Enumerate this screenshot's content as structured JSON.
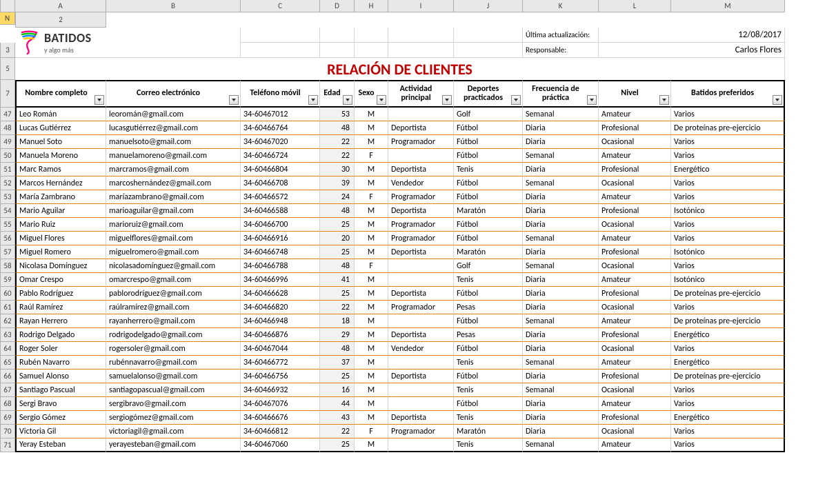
{
  "columns": [
    "A",
    "B",
    "C",
    "D",
    "H",
    "I",
    "J",
    "K",
    "L",
    "M",
    "N"
  ],
  "selected_column": "N",
  "logo": {
    "brand": "BATIDOS",
    "tagline": "y algo más"
  },
  "meta": {
    "last_update_label": "Última actualización:",
    "last_update_value": "12/08/2017",
    "resp_label": "Responsable:",
    "resp_value": "Carlos Flores"
  },
  "title": "RELACIÓN DE CLIENTES",
  "header_row_num": "7",
  "headers": [
    "Nombre completo",
    "Correo electrónico",
    "Teléfono móvil",
    "Edad",
    "Sexo",
    "Actividad principal",
    "Deportes practicados",
    "Frecuencia de práctica",
    "Nivel",
    "Batidos preferidos"
  ],
  "rows": [
    {
      "n": "47",
      "v": [
        "Leo Román",
        "leoromán@gmail.com",
        "34-60467012",
        "53",
        "M",
        "",
        "Golf",
        "Semanal",
        "Amateur",
        "Varios"
      ]
    },
    {
      "n": "48",
      "v": [
        "Lucas Gutiérrez",
        "lucasgutiérrez@gmail.com",
        "34-60466764",
        "48",
        "M",
        "Deportista",
        "Fútbol",
        "Diaria",
        "Profesional",
        "De proteínas pre-ejercicio"
      ]
    },
    {
      "n": "49",
      "v": [
        "Manuel Soto",
        "manuelsoto@gmail.com",
        "34-60467020",
        "22",
        "M",
        "Programador",
        "Fútbol",
        "Diaria",
        "Ocasional",
        "Varios"
      ]
    },
    {
      "n": "50",
      "v": [
        "Manuela Moreno",
        "manuelamoreno@gmail.com",
        "34-60466724",
        "22",
        "F",
        "",
        "Fútbol",
        "Semanal",
        "Amateur",
        "Varios"
      ]
    },
    {
      "n": "51",
      "v": [
        "Marc Ramos",
        "marcramos@gmail.com",
        "34-60466804",
        "30",
        "M",
        "Deportista",
        "Tenis",
        "Diaria",
        "Profesional",
        "Energético"
      ]
    },
    {
      "n": "52",
      "v": [
        "Marcos Hernández",
        "marcoshernández@gmail.com",
        "34-60466708",
        "39",
        "M",
        "Vendedor",
        "Fútbol",
        "Semanal",
        "Ocasional",
        "Varios"
      ]
    },
    {
      "n": "53",
      "v": [
        "María Zambrano",
        "maríazambrano@gmail.com",
        "34-60466572",
        "24",
        "F",
        "Programador",
        "Fútbol",
        "Diaria",
        "Amateur",
        "Varios"
      ]
    },
    {
      "n": "54",
      "v": [
        "Mario Aguilar",
        "marioaguilar@gmail.com",
        "34-60466588",
        "48",
        "M",
        "Deportista",
        "Maratón",
        "Diaria",
        "Profesional",
        "Isotónico"
      ]
    },
    {
      "n": "55",
      "v": [
        "Mario Ruiz",
        "marioruiz@gmail.com",
        "34-60466700",
        "25",
        "M",
        "Programador",
        "Fútbol",
        "Diaria",
        "Ocasional",
        "Varios"
      ]
    },
    {
      "n": "56",
      "v": [
        "Miguel Flores",
        "miguelflores@gmail.com",
        "34-60466916",
        "20",
        "M",
        "Programador",
        "Fútbol",
        "Semanal",
        "Amateur",
        "Varios"
      ]
    },
    {
      "n": "57",
      "v": [
        "Miguel Romero",
        "miguelromero@gmail.com",
        "34-60466748",
        "25",
        "M",
        "Deportista",
        "Maratón",
        "Diaria",
        "Profesional",
        "Isotónico"
      ]
    },
    {
      "n": "58",
      "v": [
        "Nicolasa Domínguez",
        "nicolasadomínguez@gmail.com",
        "34-60466788",
        "48",
        "F",
        "",
        "Golf",
        "Semanal",
        "Ocasional",
        "Varios"
      ]
    },
    {
      "n": "59",
      "v": [
        "Omar Crespo",
        "omarcrespo@gmail.com",
        "34-60466996",
        "41",
        "M",
        "",
        "Tenis",
        "Diaria",
        "Amateur",
        "Isotónico"
      ]
    },
    {
      "n": "60",
      "v": [
        "Pablo Rodríguez",
        "pablorodríguez@gmail.com",
        "34-60466628",
        "25",
        "M",
        "Deportista",
        "Fútbol",
        "Diaria",
        "Profesional",
        "De proteínas pre-ejercicio"
      ]
    },
    {
      "n": "61",
      "v": [
        "Raúl Ramírez",
        "raúlramírez@gmail.com",
        "34-60466820",
        "22",
        "M",
        "Programador",
        "Pesas",
        "Diaria",
        "Ocasional",
        "Varios"
      ]
    },
    {
      "n": "62",
      "v": [
        "Rayan Herrero",
        "rayanherrero@gmail.com",
        "34-60466948",
        "18",
        "M",
        "",
        "Fútbol",
        "Semanal",
        "Amateur",
        "De proteínas pre-ejercicio"
      ]
    },
    {
      "n": "63",
      "v": [
        "Rodrigo Delgado",
        "rodrigodelgado@gmail.com",
        "34-60466876",
        "29",
        "M",
        "Deportista",
        "Pesas",
        "Diaria",
        "Profesional",
        "Energético"
      ]
    },
    {
      "n": "64",
      "v": [
        "Roger Soler",
        "rogersoler@gmail.com",
        "34-60467044",
        "48",
        "M",
        "Vendedor",
        "Fútbol",
        "Diaria",
        "Ocasional",
        "Varios"
      ]
    },
    {
      "n": "65",
      "v": [
        "Rubén Navarro",
        "rubénnavarro@gmail.com",
        "34-60466772",
        "37",
        "M",
        "",
        "Tenis",
        "Semanal",
        "Amateur",
        "Energético"
      ]
    },
    {
      "n": "66",
      "v": [
        "Samuel Alonso",
        "samuelalonso@gmail.com",
        "34-60466756",
        "25",
        "M",
        "Deportista",
        "Fútbol",
        "Diaria",
        "Profesional",
        "De proteínas pre-ejercicio"
      ]
    },
    {
      "n": "67",
      "v": [
        "Santiago Pascual",
        "santiagopascual@gmail.com",
        "34-60466932",
        "16",
        "M",
        "",
        "Tenis",
        "Semanal",
        "Ocasional",
        "Varios"
      ]
    },
    {
      "n": "68",
      "v": [
        "Sergi Bravo",
        "sergibravo@gmail.com",
        "34-60467076",
        "44",
        "M",
        "",
        "Fútbol",
        "Diaria",
        "Amateur",
        "Varios"
      ]
    },
    {
      "n": "69",
      "v": [
        "Sergio Gómez",
        "sergiogómez@gmail.com",
        "34-60466676",
        "43",
        "M",
        "Deportista",
        "Tenis",
        "Diaria",
        "Profesional",
        "Energético"
      ]
    },
    {
      "n": "70",
      "v": [
        "Victoria Gil",
        "victoriagil@gmail.com",
        "34-60466812",
        "22",
        "F",
        "Programador",
        "Maratón",
        "Diaria",
        "Ocasional",
        "Varios"
      ]
    },
    {
      "n": "71",
      "v": [
        "Yeray Esteban",
        "yerayesteban@gmail.com",
        "34-60467060",
        "25",
        "M",
        "",
        "Tenis",
        "Semanal",
        "Amateur",
        "Varios"
      ]
    }
  ]
}
